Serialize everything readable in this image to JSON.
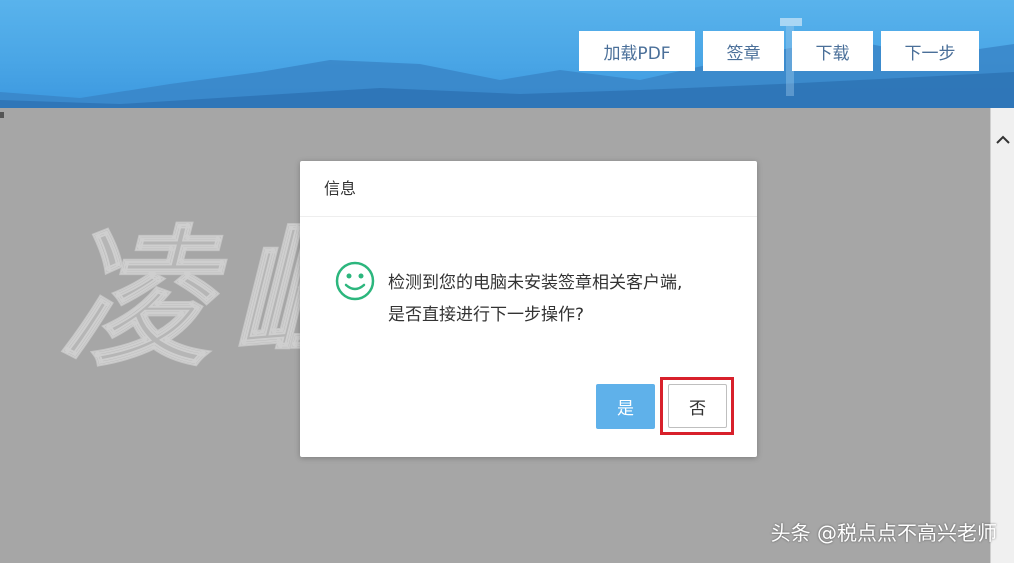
{
  "toolbar": {
    "load_pdf": "加载PDF",
    "sign": "签章",
    "download": "下载",
    "next_step": "下一步"
  },
  "watermark": "凌峰联讯",
  "dialog": {
    "title": "信息",
    "message_line1": "检测到您的电脑未安装签章相关客户端,",
    "message_line2": "是否直接进行下一步操作?",
    "yes_label": "是",
    "no_label": "否",
    "icon": "smiley-icon"
  },
  "credit": "头条 @税点点不高兴老师",
  "colors": {
    "header_blue": "#4aa6e6",
    "yes_button": "#5fb1ea",
    "highlight_red": "#d8202b",
    "smiley_green": "#2cb67d"
  }
}
